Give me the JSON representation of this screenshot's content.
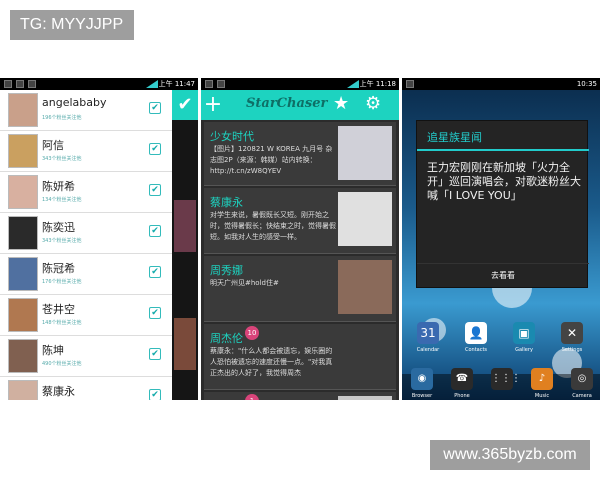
{
  "watermarks": {
    "top": "TG: MYYJJPP",
    "bottom": "www.365byzb.com"
  },
  "phone1": {
    "status_time": "上午 11:47",
    "contacts": [
      {
        "name": "angelababy",
        "sub": "196个粉丝关注他",
        "avatar_color": "#c9a08a"
      },
      {
        "name": "阿信",
        "sub": "343个粉丝关注他",
        "avatar_color": "#caa060"
      },
      {
        "name": "陈妍希",
        "sub": "134个粉丝关注他",
        "avatar_color": "#d8b0a0"
      },
      {
        "name": "陈奕迅",
        "sub": "343个粉丝关注他",
        "avatar_color": "#2a2a2a"
      },
      {
        "name": "陈冠希",
        "sub": "176个粉丝关注他",
        "avatar_color": "#5070a0"
      },
      {
        "name": "苍井空",
        "sub": "148个粉丝关注他",
        "avatar_color": "#b07850"
      },
      {
        "name": "陈坤",
        "sub": "490个粉丝关注他",
        "avatar_color": "#806050"
      },
      {
        "name": "蔡康永",
        "sub": "",
        "avatar_color": "#d0b0a0"
      }
    ],
    "checkmark": "✔",
    "side_check": "✔"
  },
  "phone2": {
    "status_time": "上午 11:18",
    "app_title": "StarChaser",
    "plus": "+",
    "star": "★",
    "gear": "⚙",
    "cards": [
      {
        "name": "少女时代",
        "text": "【图片】120821 W KOREA 九月号 杂志图2P（来源：韩媒）站内转换：http://t.cn/zW8QYEV",
        "pic_color": "#d0d0d8"
      },
      {
        "name": "蔡康永",
        "text": "对学生来说，暑假既长又短。刚开始之时，觉得暑假长；快结束之时，觉得暑假短。如我对人生的感受一样。",
        "pic_color": "#e0e0e0"
      },
      {
        "name": "周秀娜",
        "text": "明天广州见#hold住#",
        "pic_color": "#8a6a5a"
      },
      {
        "name": "周杰伦",
        "text": "蔡康永：\"什么人都会被遗忘，娱乐圈的人恐怕被遗忘的速度还慢一点。\"对我真正杰出的人好了，我觉得周杰",
        "pic_color": "#3a3a3a",
        "badge": "10"
      },
      {
        "name": "",
        "text": "",
        "pic_color": "#c8c8c8",
        "badge": "1"
      }
    ]
  },
  "phone3": {
    "status_time": "10:35",
    "dialog_title": "追星族星闻",
    "dialog_message": "王力宏刚刚在新加坡「火力全开」巡回演唱会，对歌迷粉丝大喊「I LOVE YOU」",
    "dialog_button": "去看看",
    "apps": [
      {
        "label": "Calendar",
        "icon": "31",
        "color": "#3a6ab0"
      },
      {
        "label": "Contacts",
        "icon": "👤",
        "color": "#ffffff"
      },
      {
        "label": "Gallery",
        "icon": "▣",
        "color": "#1a8ab0"
      },
      {
        "label": "Settings",
        "icon": "✕",
        "color": "#444444"
      }
    ],
    "dock": [
      {
        "label": "Browser",
        "icon": "◉",
        "color": "#2a6aa0"
      },
      {
        "label": "Phone",
        "icon": "☎",
        "color": "#2a2a2a"
      },
      {
        "label": "",
        "icon": "⋮⋮⋮",
        "color": "#2a2a2a"
      },
      {
        "label": "Music",
        "icon": "♪",
        "color": "#e08020"
      },
      {
        "label": "Camera",
        "icon": "◎",
        "color": "#3a3a3a"
      }
    ]
  }
}
